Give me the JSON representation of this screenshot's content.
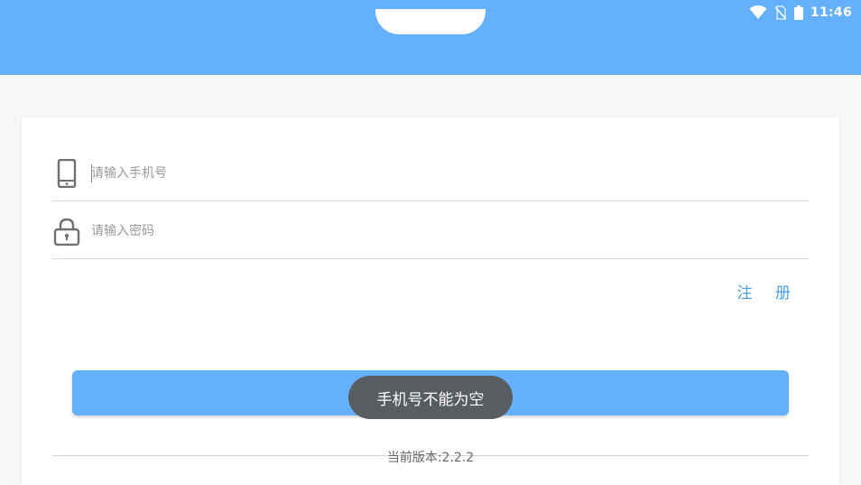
{
  "status_bar": {
    "time": "11:46",
    "icons": [
      "wifi-icon",
      "no-sim-icon",
      "battery-icon"
    ]
  },
  "login_form": {
    "phone_placeholder": "请输入手机号",
    "phone_icon": "phone-icon",
    "password_placeholder": "请输入密码",
    "password_icon": "lock-icon",
    "register_label": "注 册",
    "login_label": ""
  },
  "version": {
    "label": "当前版本:2.2.2"
  },
  "toast": {
    "message": "手机号不能为空"
  },
  "colors": {
    "header": "#64b0fd",
    "button": "#64b0fd",
    "link": "#4a9de6",
    "toast": "#595c61"
  }
}
